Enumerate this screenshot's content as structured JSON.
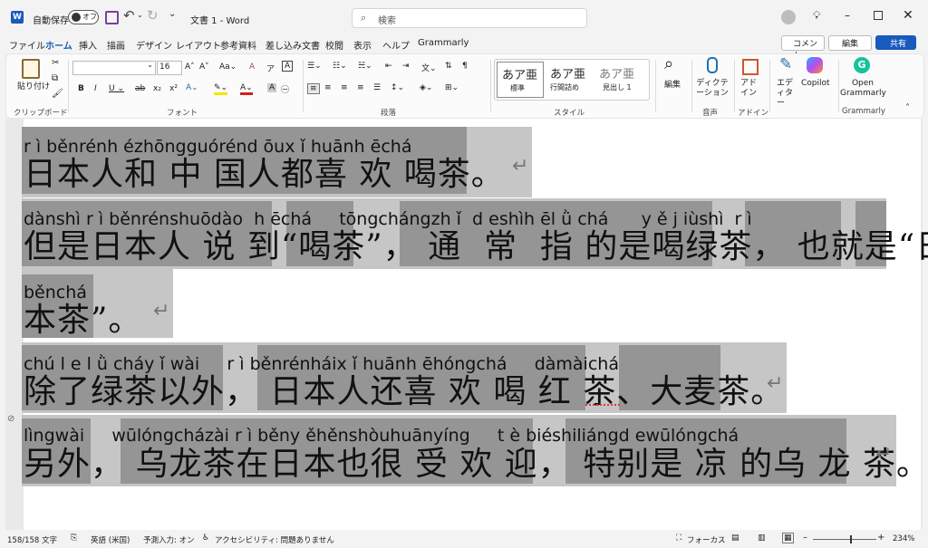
{
  "titlebar": {
    "app_icon": "word-icon",
    "autosave_label": "自動保存",
    "autosave_state": "オフ",
    "doc_title": "文書 1  -  Word",
    "search_placeholder": "検索"
  },
  "menu": {
    "items": [
      "ファイル",
      "ホーム",
      "挿入",
      "描画",
      "デザイン",
      "レイアウト",
      "参考資料",
      "差し込み文書",
      "校閲",
      "表示",
      "ヘルプ",
      "Grammarly"
    ],
    "active": "ホーム",
    "comment_label": "コメント",
    "edit_label": "編集",
    "share_label": "共有"
  },
  "ribbon": {
    "paste_label": "貼り付け",
    "font_name": "",
    "font_size": "16",
    "styles": [
      {
        "sample": "あア亜",
        "label": "標準"
      },
      {
        "sample": "あア亜",
        "label": "行間詰め"
      },
      {
        "sample": "あア亜",
        "label": "見出し 1"
      }
    ],
    "search_label": "編集",
    "dictation_label": "ディクテーション",
    "addin_label": "アドイン",
    "editor_label": "エディター",
    "copilot_label": "Copilot",
    "grammarly_label": "Open Grammarly",
    "groups": [
      "クリップボード",
      "フォント",
      "段落",
      "スタイル",
      "音声",
      "アドイン",
      "Grammarly"
    ]
  },
  "document": {
    "lines": [
      {
        "ruby": "r ì běnrénh ézhōngguórénd ōux ǐ huānh ēchá",
        "base": "日本人和 中 国人都喜 欢 喝茶。"
      },
      {
        "ruby": "dànshì r ì běnrénshuōdào  h ēchá     tōngchángzh ǐ  d eshìh ēl ǜ chá      y ě j iùshì  r ì",
        "base": "但是日本人 说 到“喝茶”， 通  常  指 的是喝绿茶， 也就是“日"
      },
      {
        "ruby": "běnchá",
        "base": "本茶”。"
      },
      {
        "ruby": "chú l e l ǜ cháy ǐ wài     r ì běnrénháix ǐ huānh ēhóngchá     dàmàichá",
        "base": "除了绿茶以外， 日本人还喜 欢 喝 红 茶、大麦茶。"
      },
      {
        "ruby": "lìngwài     wūlóngcházài r ì běny ěhěnshòuhuānyíng     t è biéshiliángd ewūlóngchá",
        "base": "另外， 乌龙茶在日本也很 受 欢 迎， 特别是 凉 的乌 龙 茶。"
      }
    ],
    "paragraph_mark": "↵"
  },
  "status": {
    "word_count": "158/158 文字",
    "language": "英語 (米国)",
    "predict": "予測入力: オン",
    "accessibility": "アクセシビリティ: 問題ありません",
    "focus": "フォーカス",
    "zoom": "234%"
  }
}
